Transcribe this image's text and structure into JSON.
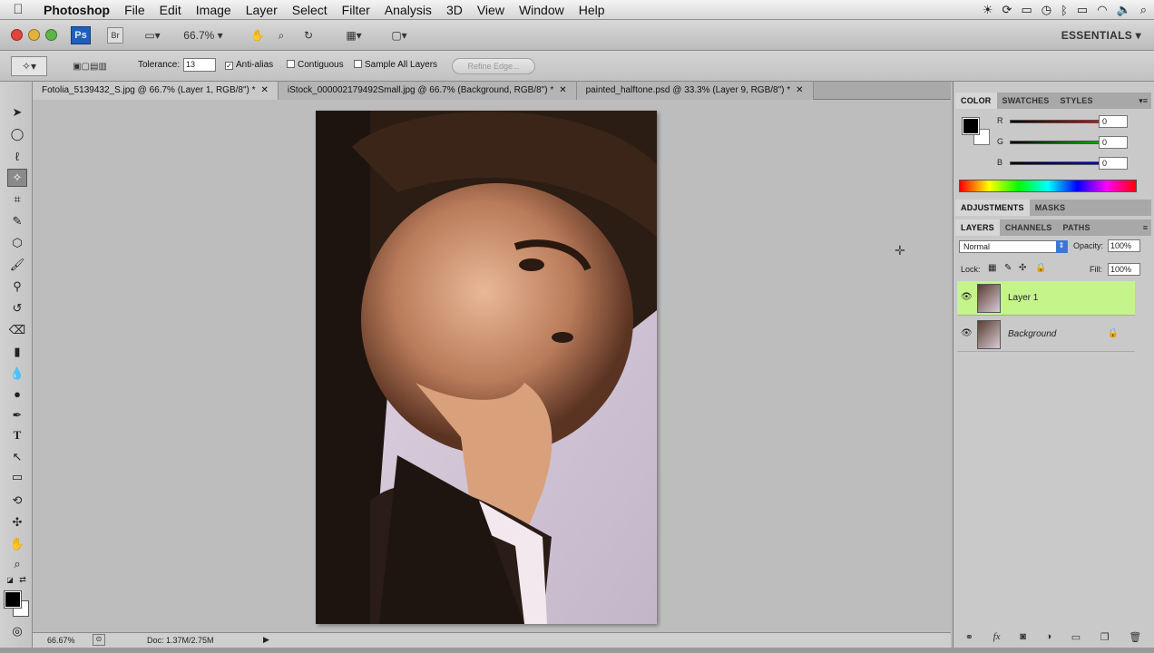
{
  "menubar": {
    "apple": "",
    "app_name": "Photoshop",
    "items": [
      "File",
      "Edit",
      "Image",
      "Layer",
      "Select",
      "Filter",
      "Analysis",
      "3D",
      "View",
      "Window",
      "Help"
    ]
  },
  "appbar": {
    "ps_logo": "Ps",
    "br_logo": "Br",
    "zoom": "66.7%",
    "workspace": "ESSENTIALS ▾"
  },
  "options": {
    "tolerance_label": "Tolerance:",
    "tolerance_value": "13",
    "anti_alias": "Anti-alias",
    "contiguous": "Contiguous",
    "sample_all": "Sample All Layers",
    "refine": "Refine Edge..."
  },
  "tabs": [
    {
      "label": "Fotolia_5139432_S.jpg @ 66.7% (Layer 1, RGB/8\") *"
    },
    {
      "label": "iStock_000002179492Small.jpg @ 66.7% (Background, RGB/8\") *"
    },
    {
      "label": "painted_halftone.psd @ 33.3% (Layer 9, RGB/8\") *"
    }
  ],
  "status": {
    "zoom": "66.67%",
    "doc": "Doc: 1.37M/2.75M"
  },
  "color_panel": {
    "tabs": [
      "COLOR",
      "SWATCHES",
      "STYLES"
    ],
    "r_label": "R",
    "g_label": "G",
    "b_label": "B",
    "r_value": "0",
    "g_value": "0",
    "b_value": "0"
  },
  "adjust_panel": {
    "tabs": [
      "ADJUSTMENTS",
      "MASKS"
    ]
  },
  "layers_panel": {
    "tabs": [
      "LAYERS",
      "CHANNELS",
      "PATHS"
    ],
    "blend_mode": "Normal",
    "opacity_label": "Opacity:",
    "opacity_value": "100%",
    "lock_label": "Lock:",
    "fill_label": "Fill:",
    "fill_value": "100%",
    "layers": [
      {
        "name": "Layer 1"
      },
      {
        "name": "Background"
      }
    ]
  },
  "colors": {
    "selected_layer": "#c4f48a",
    "ps_blue": "#1f5fb8"
  }
}
